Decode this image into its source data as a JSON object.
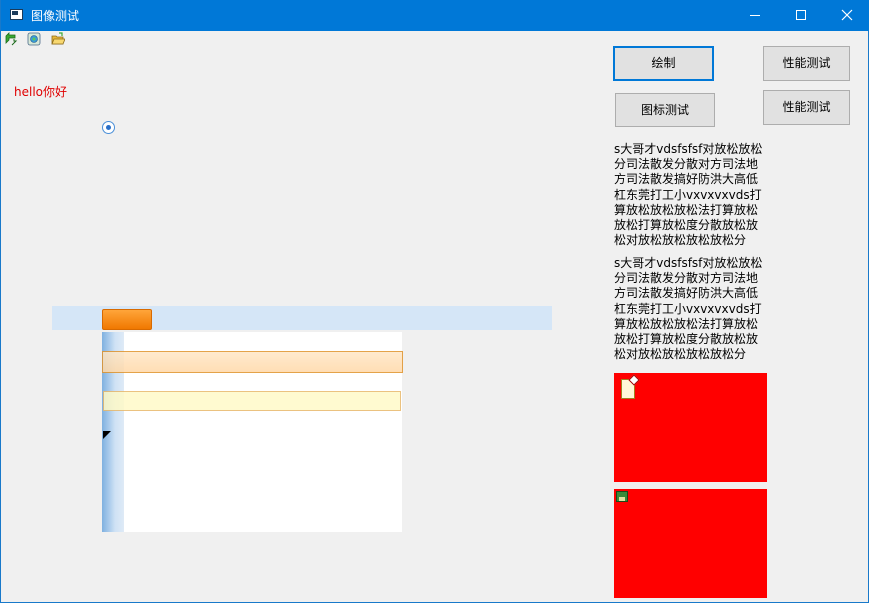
{
  "window": {
    "title": "图像测试"
  },
  "toolbar": {
    "icons": [
      "refresh-arrow-icon",
      "app-globe-icon",
      "folder-open-icon"
    ]
  },
  "canvas": {
    "hello_text": "hello你好"
  },
  "buttons": {
    "draw": "绘制",
    "perf_test_1": "性能测试",
    "icon_test": "图标测试",
    "perf_test_2": "性能测试"
  },
  "text_blocks": {
    "block1": "s大哥才vdsfsfsf对放松放松分司法散发分散对方司法地方司法散发搞好防洪大高低杠东莞打工小vxvxvxvds打算放松放松放松法打算放松放松打算放松度分散放松放松对放松放松放松放松分",
    "block2": "s大哥才vdsfsfsf对放松放松分司法散发分散对方司法地方司法散发搞好防洪大高低杠东莞打工小vxvxvxvds打算放松放松放松法打算放松放松打算放松度分散放松放松对放松放松放松放松分"
  },
  "colors": {
    "titlebar": "#0078d7",
    "red_box": "#ff0000",
    "orange_button": "#f88c1a",
    "band": "#d5e6f7"
  }
}
